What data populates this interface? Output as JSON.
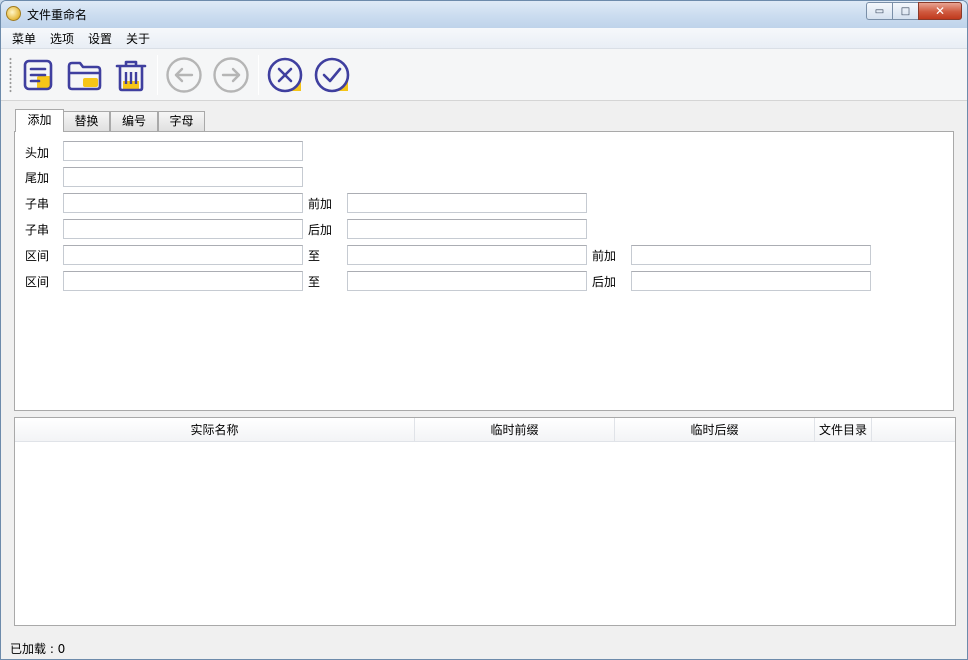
{
  "window": {
    "title": "文件重命名",
    "minimize_glyph": "▭",
    "maximize_glyph": "□",
    "close_glyph": "✕"
  },
  "menu": [
    "菜单",
    "选项",
    "设置",
    "关于"
  ],
  "toolbar": {
    "buttons": [
      "new-list-icon",
      "open-folder-icon",
      "trash-icon",
      "back-arrow-icon",
      "forward-arrow-icon",
      "cancel-icon",
      "confirm-icon"
    ],
    "accent": "#3f3f9f",
    "highlight": "#f5c518",
    "disabled": "#b5b5b5"
  },
  "tabs": [
    "添加",
    "替换",
    "编号",
    "字母"
  ],
  "active_tab": 0,
  "form": {
    "rows": [
      {
        "label": "头加",
        "value": ""
      },
      {
        "label": "尾加",
        "value": ""
      },
      {
        "label": "子串",
        "value": "",
        "label2": "前加",
        "value2": ""
      },
      {
        "label": "子串",
        "value": "",
        "label2": "后加",
        "value2": ""
      },
      {
        "label": "区间",
        "value": "",
        "label2": "至",
        "value2": "",
        "label3": "前加",
        "value3": ""
      },
      {
        "label": "区间",
        "value": "",
        "label2": "至",
        "value2": "",
        "label3": "后加",
        "value3": ""
      }
    ]
  },
  "table": {
    "columns": [
      "实际名称",
      "临时前缀",
      "临时后缀",
      "文件目录"
    ],
    "rows": []
  },
  "status": {
    "text": "已加载 : 0"
  }
}
